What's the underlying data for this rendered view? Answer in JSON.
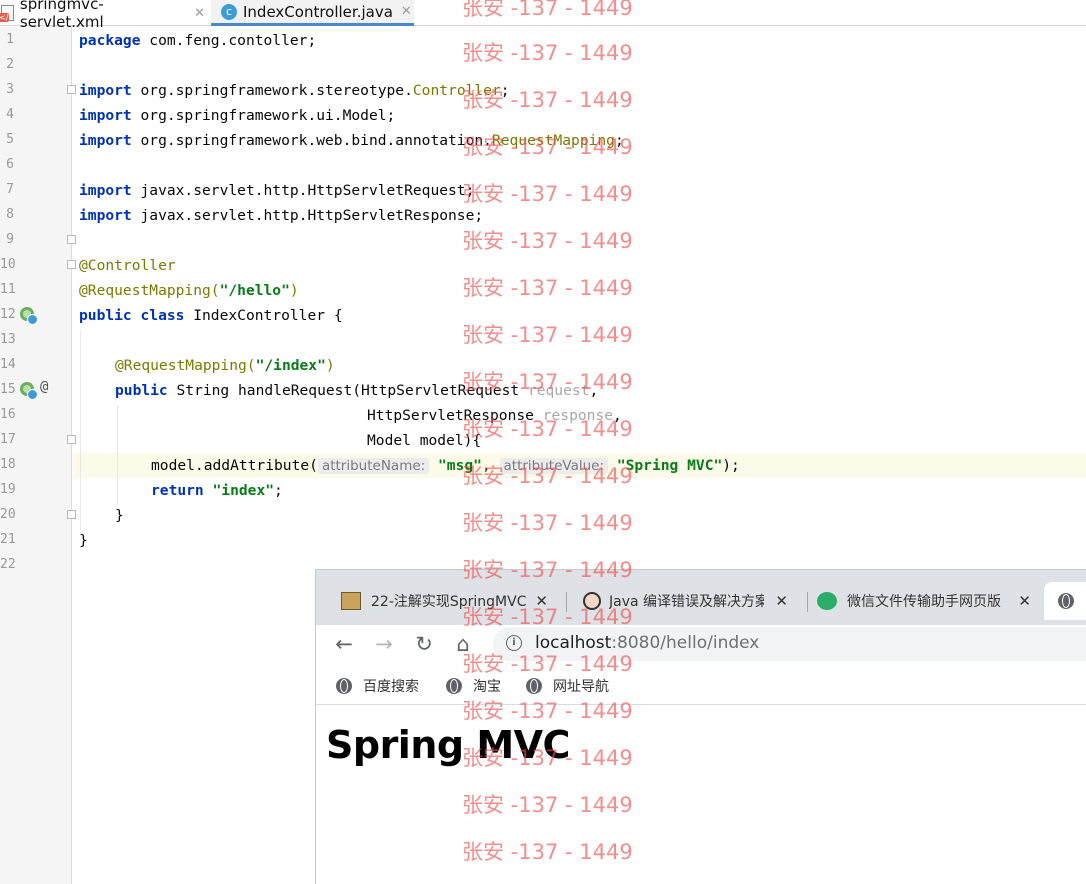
{
  "ide": {
    "tabs": [
      {
        "name": "springmvc-servlet.xml",
        "icon": "xml-file-icon",
        "active": false
      },
      {
        "name": "IndexController.java",
        "icon": "java-class-icon",
        "active": true
      }
    ],
    "tab_close_glyph": "✕",
    "line_numbers": [
      "1",
      "2",
      "3",
      "4",
      "5",
      "6",
      "7",
      "8",
      "9",
      "10",
      "11",
      "12",
      "13",
      "14",
      "15",
      "16",
      "17",
      "18",
      "19",
      "20",
      "21",
      "22"
    ],
    "code": {
      "l1_kw": "package",
      "l1_rest": " com.feng.contoller;",
      "import_kw": "import",
      "l3_a": " org.springframework.stereotype.",
      "l3_b": "Controller",
      "l3_c": ";",
      "l4_a": " org.springframework.ui.Model;",
      "l5_a": " org.springframework.web.bind.annotation.",
      "l5_b": "RequestMapping",
      "l5_c": ";",
      "l7_a": " javax.servlet.http.HttpServletRequest;",
      "l8_a": " javax.servlet.http.HttpServletResponse;",
      "l10": "@Controller",
      "l11_a": "@RequestMapping(",
      "l11_str": "\"/hello\"",
      "l11_c": ")",
      "l12_kw1": "public",
      "l12_kw2": "class",
      "l12_rest": " IndexController {",
      "l14_a": "@RequestMapping(",
      "l14_str": "\"/index\"",
      "l14_c": ")",
      "l15_kw": "public",
      "l15_rest": " String handleRequest(HttpServletRequest ",
      "l15_param": "request",
      "l15_end": ",",
      "l16_rest": "HttpServletResponse ",
      "l16_param": "response",
      "l16_end": ",",
      "l17": "Model model){",
      "l18_a": "model.addAttribute(",
      "l18_hint1": "attributeName:",
      "l18_str1": "\"msg\"",
      "l18_comma": ", ",
      "l18_hint2": "attributeValue:",
      "l18_str2": "\"Spring MVC\"",
      "l18_end": ");",
      "l19_kw": "return",
      "l19_str": "\"index\"",
      "l19_end": ";",
      "l20": "}",
      "l21": "}"
    }
  },
  "browser": {
    "tabs": [
      {
        "title": "22-注解实现SpringMVC",
        "favicon": "image-favicon"
      },
      {
        "title": "Java 编译错误及解决方案",
        "favicon": "avatar-favicon"
      },
      {
        "title": "微信文件传输助手网页版",
        "favicon": "wechat-favicon"
      }
    ],
    "tab_close_glyph": "✕",
    "nav": {
      "back": "←",
      "forward": "→",
      "reload": "↻",
      "home": "⌂"
    },
    "url_host": "localhost",
    "url_rest": ":8080/hello/index",
    "bookmarks": [
      "百度搜索",
      "淘宝",
      "网址导航"
    ],
    "page_heading": "Spring MVC"
  },
  "watermark": "张安 -137 - 1449"
}
